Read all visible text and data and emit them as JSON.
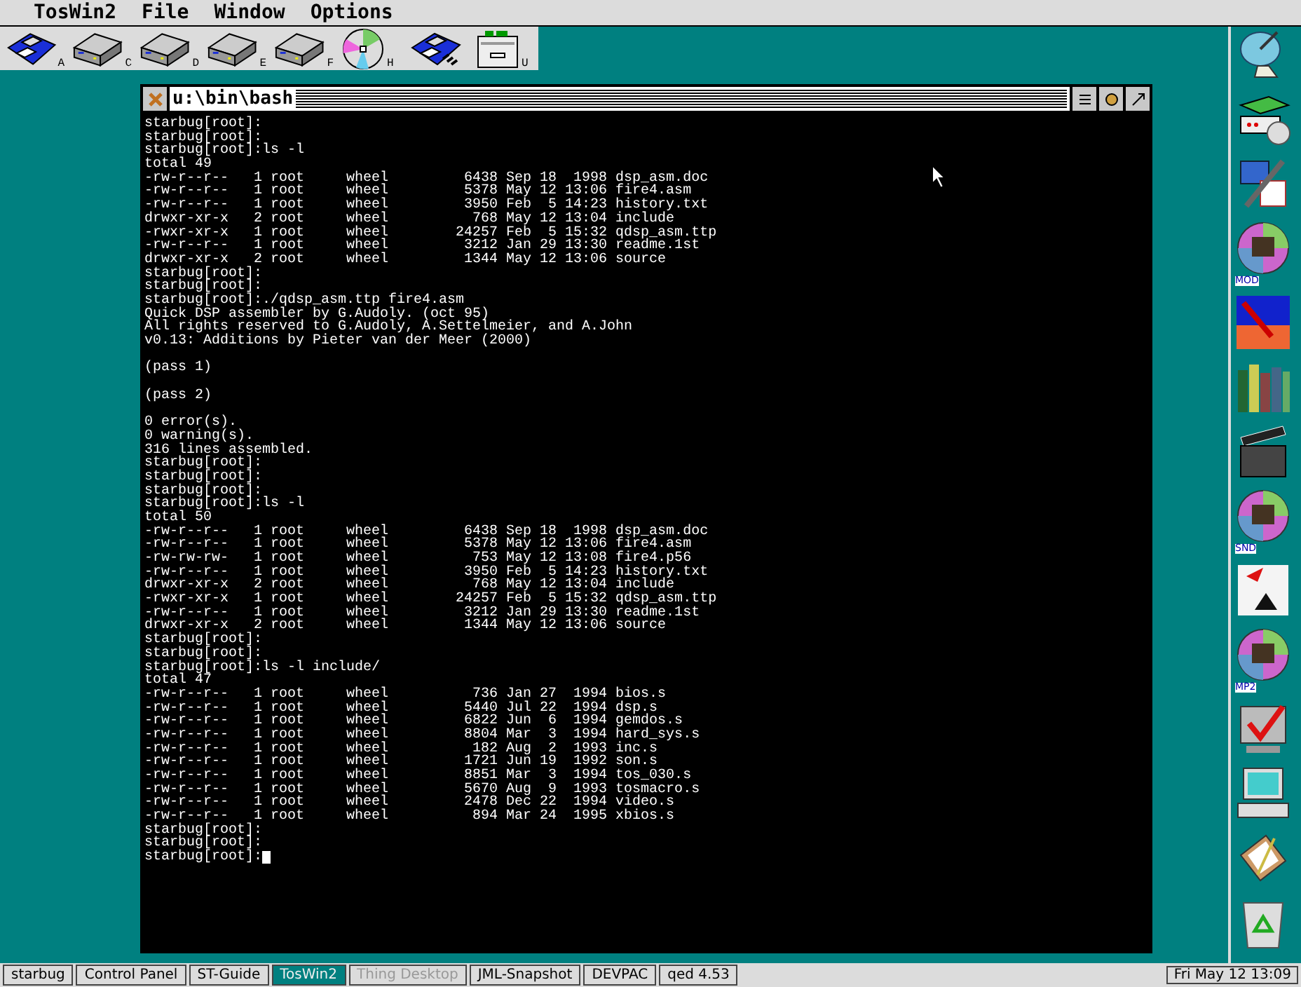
{
  "menu_bar": {
    "items": [
      "TosWin2",
      "File",
      "Window",
      "Options"
    ]
  },
  "drives": [
    {
      "kind": "floppy",
      "label": "A"
    },
    {
      "kind": "hdd",
      "label": "C"
    },
    {
      "kind": "hdd",
      "label": "D"
    },
    {
      "kind": "hdd",
      "label": "E"
    },
    {
      "kind": "hdd",
      "label": "F"
    },
    {
      "kind": "cd",
      "label": "H"
    },
    {
      "kind": "floppy-chip"
    },
    {
      "kind": "cabinet",
      "label": "U"
    }
  ],
  "window": {
    "title": "u:\\bin\\bash",
    "blocks": [
      [
        "starbug[root]:",
        "starbug[root]:",
        "starbug[root]:ls -l",
        "total 49",
        "-rw-r--r--   1 root     wheel         6438 Sep 18  1998 dsp_asm.doc",
        "-rw-r--r--   1 root     wheel         5378 May 12 13:06 fire4.asm",
        "-rw-r--r--   1 root     wheel         3950 Feb  5 14:23 history.txt",
        "drwxr-xr-x   2 root     wheel          768 May 12 13:04 include",
        "-rwxr-xr-x   1 root     wheel        24257 Feb  5 15:32 qdsp_asm.ttp",
        "-rw-r--r--   1 root     wheel         3212 Jan 29 13:30 readme.1st",
        "drwxr-xr-x   2 root     wheel         1344 May 12 13:06 source",
        "starbug[root]:",
        "starbug[root]:",
        "starbug[root]:./qdsp_asm.ttp fire4.asm",
        "Quick DSP assembler by G.Audoly. (oct 95)",
        "All rights reserved to G.Audoly, A.Settelmeier, and A.John",
        "v0.13: Additions by Pieter van der Meer (2000)"
      ],
      [
        "(pass 1)"
      ],
      [
        "(pass 2)"
      ],
      [
        "0 error(s).",
        "0 warning(s).",
        "316 lines assembled.",
        "starbug[root]:",
        "starbug[root]:",
        "starbug[root]:",
        "starbug[root]:ls -l",
        "total 50",
        "-rw-r--r--   1 root     wheel         6438 Sep 18  1998 dsp_asm.doc",
        "-rw-r--r--   1 root     wheel         5378 May 12 13:06 fire4.asm",
        "-rw-rw-rw-   1 root     wheel          753 May 12 13:08 fire4.p56",
        "-rw-r--r--   1 root     wheel         3950 Feb  5 14:23 history.txt",
        "drwxr-xr-x   2 root     wheel          768 May 12 13:04 include",
        "-rwxr-xr-x   1 root     wheel        24257 Feb  5 15:32 qdsp_asm.ttp",
        "-rw-r--r--   1 root     wheel         3212 Jan 29 13:30 readme.1st",
        "drwxr-xr-x   2 root     wheel         1344 May 12 13:06 source",
        "starbug[root]:",
        "starbug[root]:",
        "starbug[root]:ls -l include/",
        "total 47",
        "-rw-r--r--   1 root     wheel          736 Jan 27  1994 bios.s",
        "-rw-r--r--   1 root     wheel         5440 Jul 22  1994 dsp.s",
        "-rw-r--r--   1 root     wheel         6822 Jun  6  1994 gemdos.s",
        "-rw-r--r--   1 root     wheel         8804 Mar  3  1994 hard_sys.s",
        "-rw-r--r--   1 root     wheel          182 Aug  2  1993 inc.s",
        "-rw-r--r--   1 root     wheel         1721 Jun 19  1992 son.s",
        "-rw-r--r--   1 root     wheel         8851 Mar  3  1994 tos_030.s",
        "-rw-r--r--   1 root     wheel         5670 Aug  9  1993 tosmacro.s",
        "-rw-r--r--   1 root     wheel         2478 Dec 22  1994 video.s",
        "-rw-r--r--   1 root     wheel          894 Mar 24  1995 xbios.s",
        "starbug[root]:",
        "starbug[root]:",
        "starbug[root]:"
      ]
    ]
  },
  "dock": [
    {
      "kind": "dish"
    },
    {
      "kind": "hardware"
    },
    {
      "kind": "tools"
    },
    {
      "kind": "music-disc",
      "label": "MOD"
    },
    {
      "kind": "paint"
    },
    {
      "kind": "books"
    },
    {
      "kind": "clapper"
    },
    {
      "kind": "music-disc",
      "label": "SND"
    },
    {
      "kind": "cards"
    },
    {
      "kind": "music-disc",
      "label": "MP2"
    },
    {
      "kind": "check"
    },
    {
      "kind": "computer"
    },
    {
      "kind": "clipboard"
    },
    {
      "kind": "recycle"
    }
  ],
  "taskbar": {
    "items": [
      {
        "label": "starbug",
        "selected": false,
        "disabled": false
      },
      {
        "label": "Control Panel",
        "selected": false,
        "disabled": false
      },
      {
        "label": "ST-Guide",
        "selected": false,
        "disabled": false
      },
      {
        "label": "TosWin2",
        "selected": true,
        "disabled": false
      },
      {
        "label": "Thing Desktop",
        "selected": false,
        "disabled": true
      },
      {
        "label": "JML-Snapshot",
        "selected": false,
        "disabled": false
      },
      {
        "label": "DEVPAC",
        "selected": false,
        "disabled": false
      },
      {
        "label": "qed 4.53",
        "selected": false,
        "disabled": false
      }
    ],
    "clock": "Fri May 12 13:09"
  }
}
